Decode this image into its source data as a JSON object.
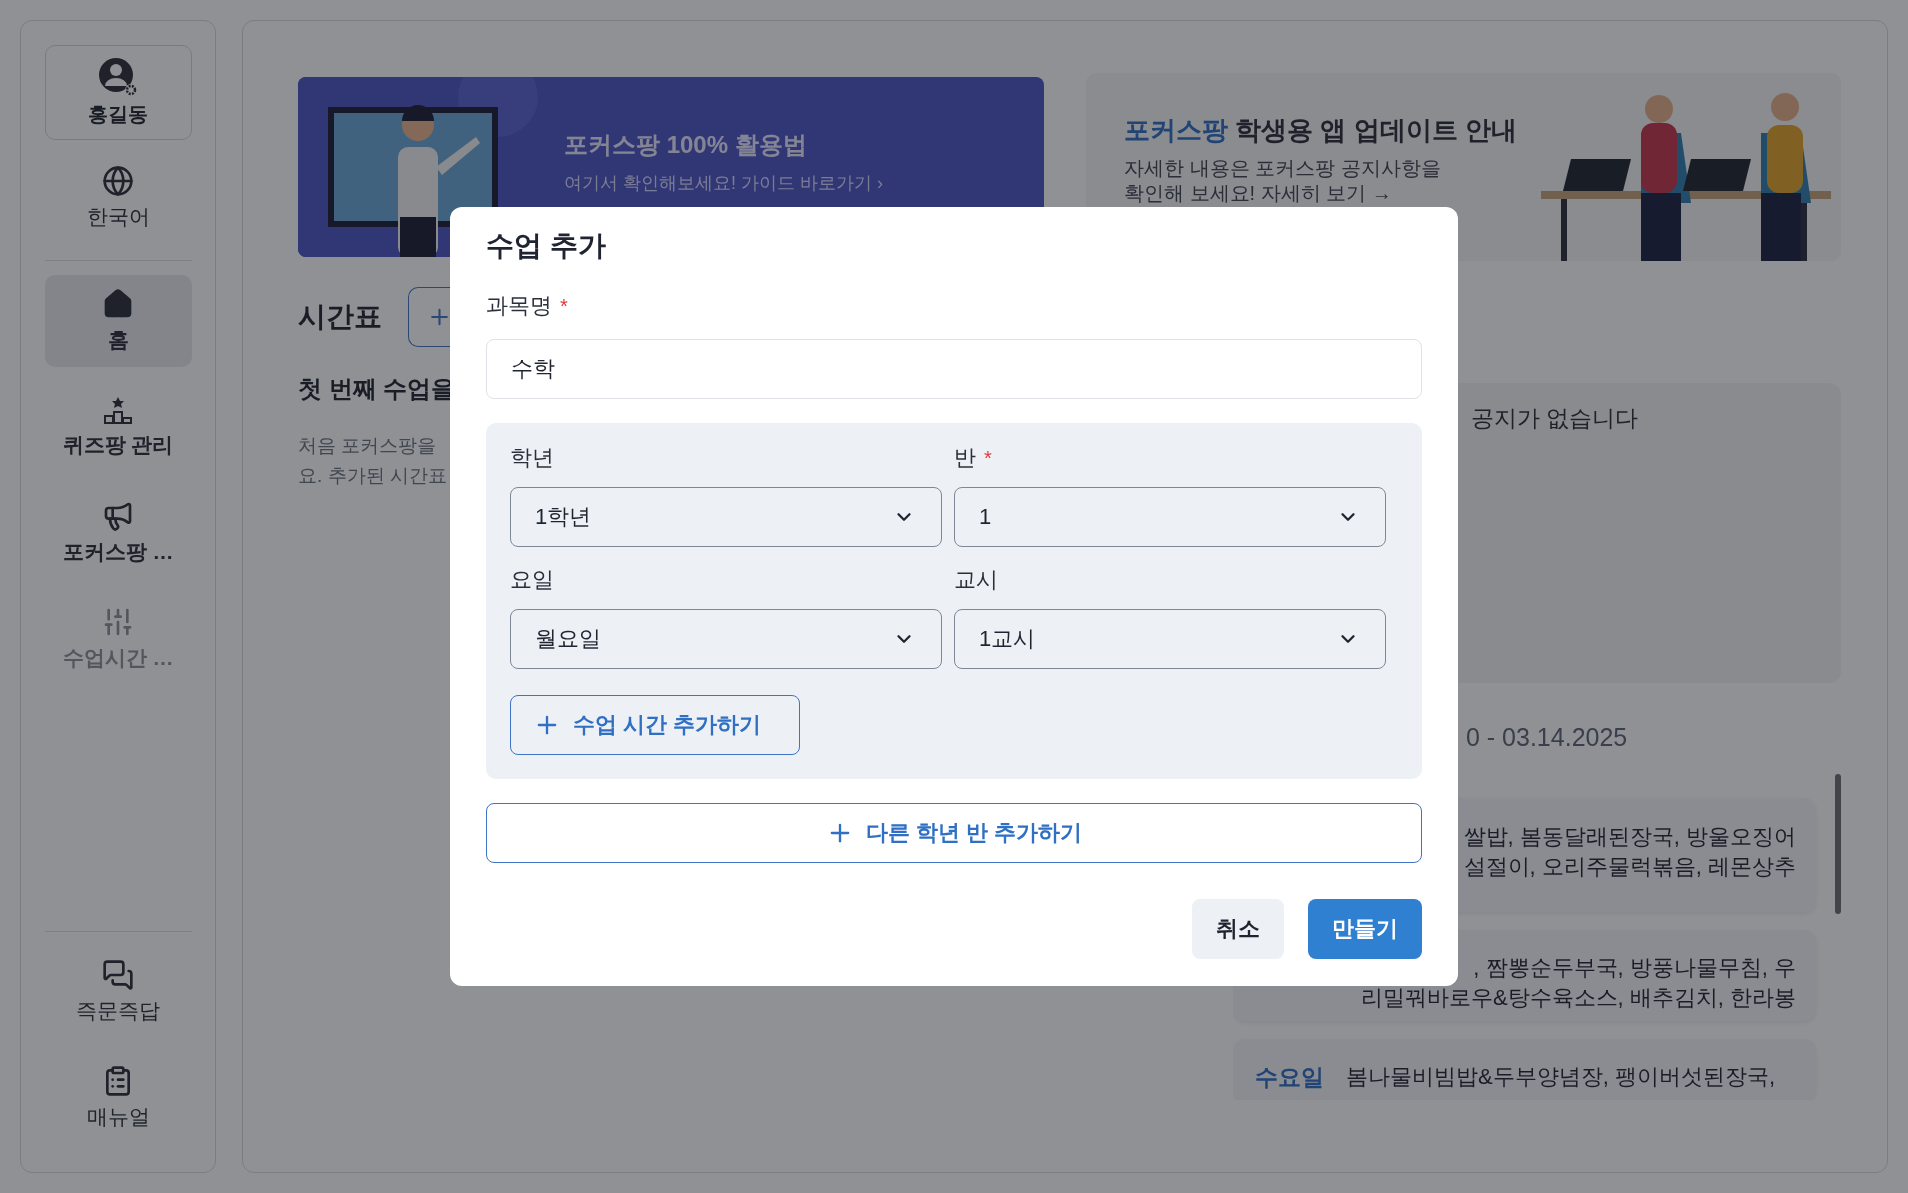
{
  "sidebar": {
    "profile": {
      "name": "홍길동"
    },
    "items": [
      {
        "label": "한국어",
        "selected": false,
        "disabled": false
      },
      {
        "label": "홈",
        "selected": true,
        "disabled": false
      },
      {
        "label": "퀴즈팡 관리",
        "selected": false,
        "disabled": false
      },
      {
        "label": "포커스팡 …",
        "selected": false,
        "disabled": false
      },
      {
        "label": "수업시간 …",
        "selected": false,
        "disabled": true
      },
      {
        "label": "즉문즉답",
        "selected": false,
        "disabled": false
      },
      {
        "label": "매뉴얼",
        "selected": false,
        "disabled": false
      }
    ]
  },
  "guide_banner": {
    "title": "포커스팡 100% 활용법",
    "link": "여기서 확인해보세요! 가이드 바로가기 ›"
  },
  "update_banner": {
    "title_highlight": "포커스팡",
    "title": "학생용 앱 업데이트 안내",
    "body_lines": [
      "자세한 내용은 포커스팡 공지사항을",
      "확인해 보세요! 자세히 보기 →"
    ]
  },
  "timetable": {
    "title": "시간표",
    "empty_title": "첫 번째 수업을",
    "empty_lines": [
      "처음 포커스팡을",
      "요. 추가된 시간표"
    ]
  },
  "notices": {
    "empty": "공지가 없습니다"
  },
  "meals": {
    "date_range": "0 - 03.14.2025",
    "cards": [
      {
        "lines": [
          "쌀밥, 봄동달래된장국, 방울오징어",
          "설절이, 오리주물럭볶음, 레몬상추"
        ]
      },
      {
        "lines": [
          ", 짬뽕순두부국, 방풍나물무침, 우",
          "리밀꿔바로우&탕수육소스, 배추김치, 한라봉"
        ]
      },
      {
        "day": "수요일",
        "lines": [
          "봄나물비빔밥&두부양념장, 팽이버섯된장국,"
        ]
      }
    ]
  },
  "dialog": {
    "title": "수업 추가",
    "subject": {
      "label": "과목명",
      "required_mark": "*",
      "value": "수학"
    },
    "selects": [
      {
        "label": "학년",
        "value": "1학년"
      },
      {
        "label": "반",
        "required_mark": "*",
        "value": "1"
      },
      {
        "label": "요일",
        "value": "월요일"
      },
      {
        "label": "교시",
        "value": "1교시"
      }
    ],
    "add_time_button": "수업 시간 추가하기",
    "add_class_button": "다른 학년 반 추가하기",
    "cancel_button": "취소",
    "create_button": "만들기"
  }
}
